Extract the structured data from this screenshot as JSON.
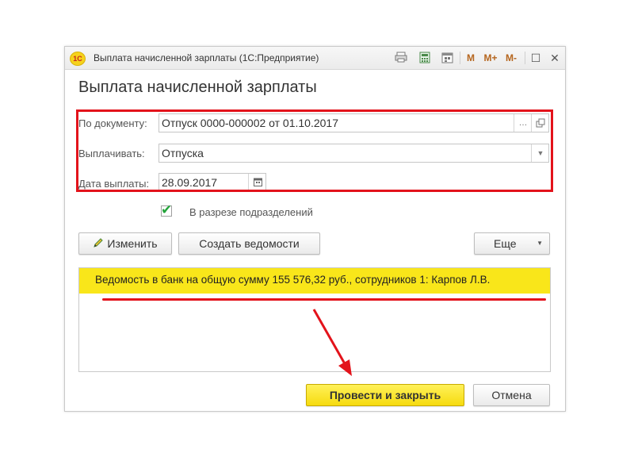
{
  "window": {
    "title": "Выплата начисленной зарплаты (1С:Предприятие)",
    "logo": "1С",
    "toolbar_icons": [
      "print-icon",
      "calculator-icon",
      "calendar-icon",
      "m-memory-icon",
      "m-plus-memory-icon",
      "m-minus-memory-icon",
      "maximize-icon",
      "close-icon"
    ],
    "memory_labels": {
      "m": "M",
      "m_plus": "M+",
      "m_minus": "M-"
    },
    "maximize_glyph": "☐",
    "close_glyph": "✕"
  },
  "form": {
    "title": "Выплата начисленной зарплаты",
    "fields": {
      "document": {
        "label": "По документу:",
        "value": "Отпуск 0000-000002 от 01.10.2017"
      },
      "pay_type": {
        "label": "Выплачивать:",
        "value": "Отпуска"
      },
      "pay_date": {
        "label": "Дата выплаты:",
        "value": "28.09.2017"
      }
    },
    "checkbox": {
      "label": "В разрезе подразделений",
      "checked": true
    },
    "buttons": {
      "edit": "Изменить",
      "create_statements": "Создать ведомости",
      "more": "Еще",
      "post_and_close": "Провести  и закрыть",
      "cancel": "Отмена"
    },
    "result_text": "Ведомость в банк на общую сумму 155 576,32 руб., сотрудников 1: Карпов Л.В."
  },
  "colors": {
    "highlight_red": "#e3131b",
    "banner_yellow": "#f9e61a",
    "primary_button_yellow": "#f6db0f",
    "check_green": "#23a33a"
  }
}
